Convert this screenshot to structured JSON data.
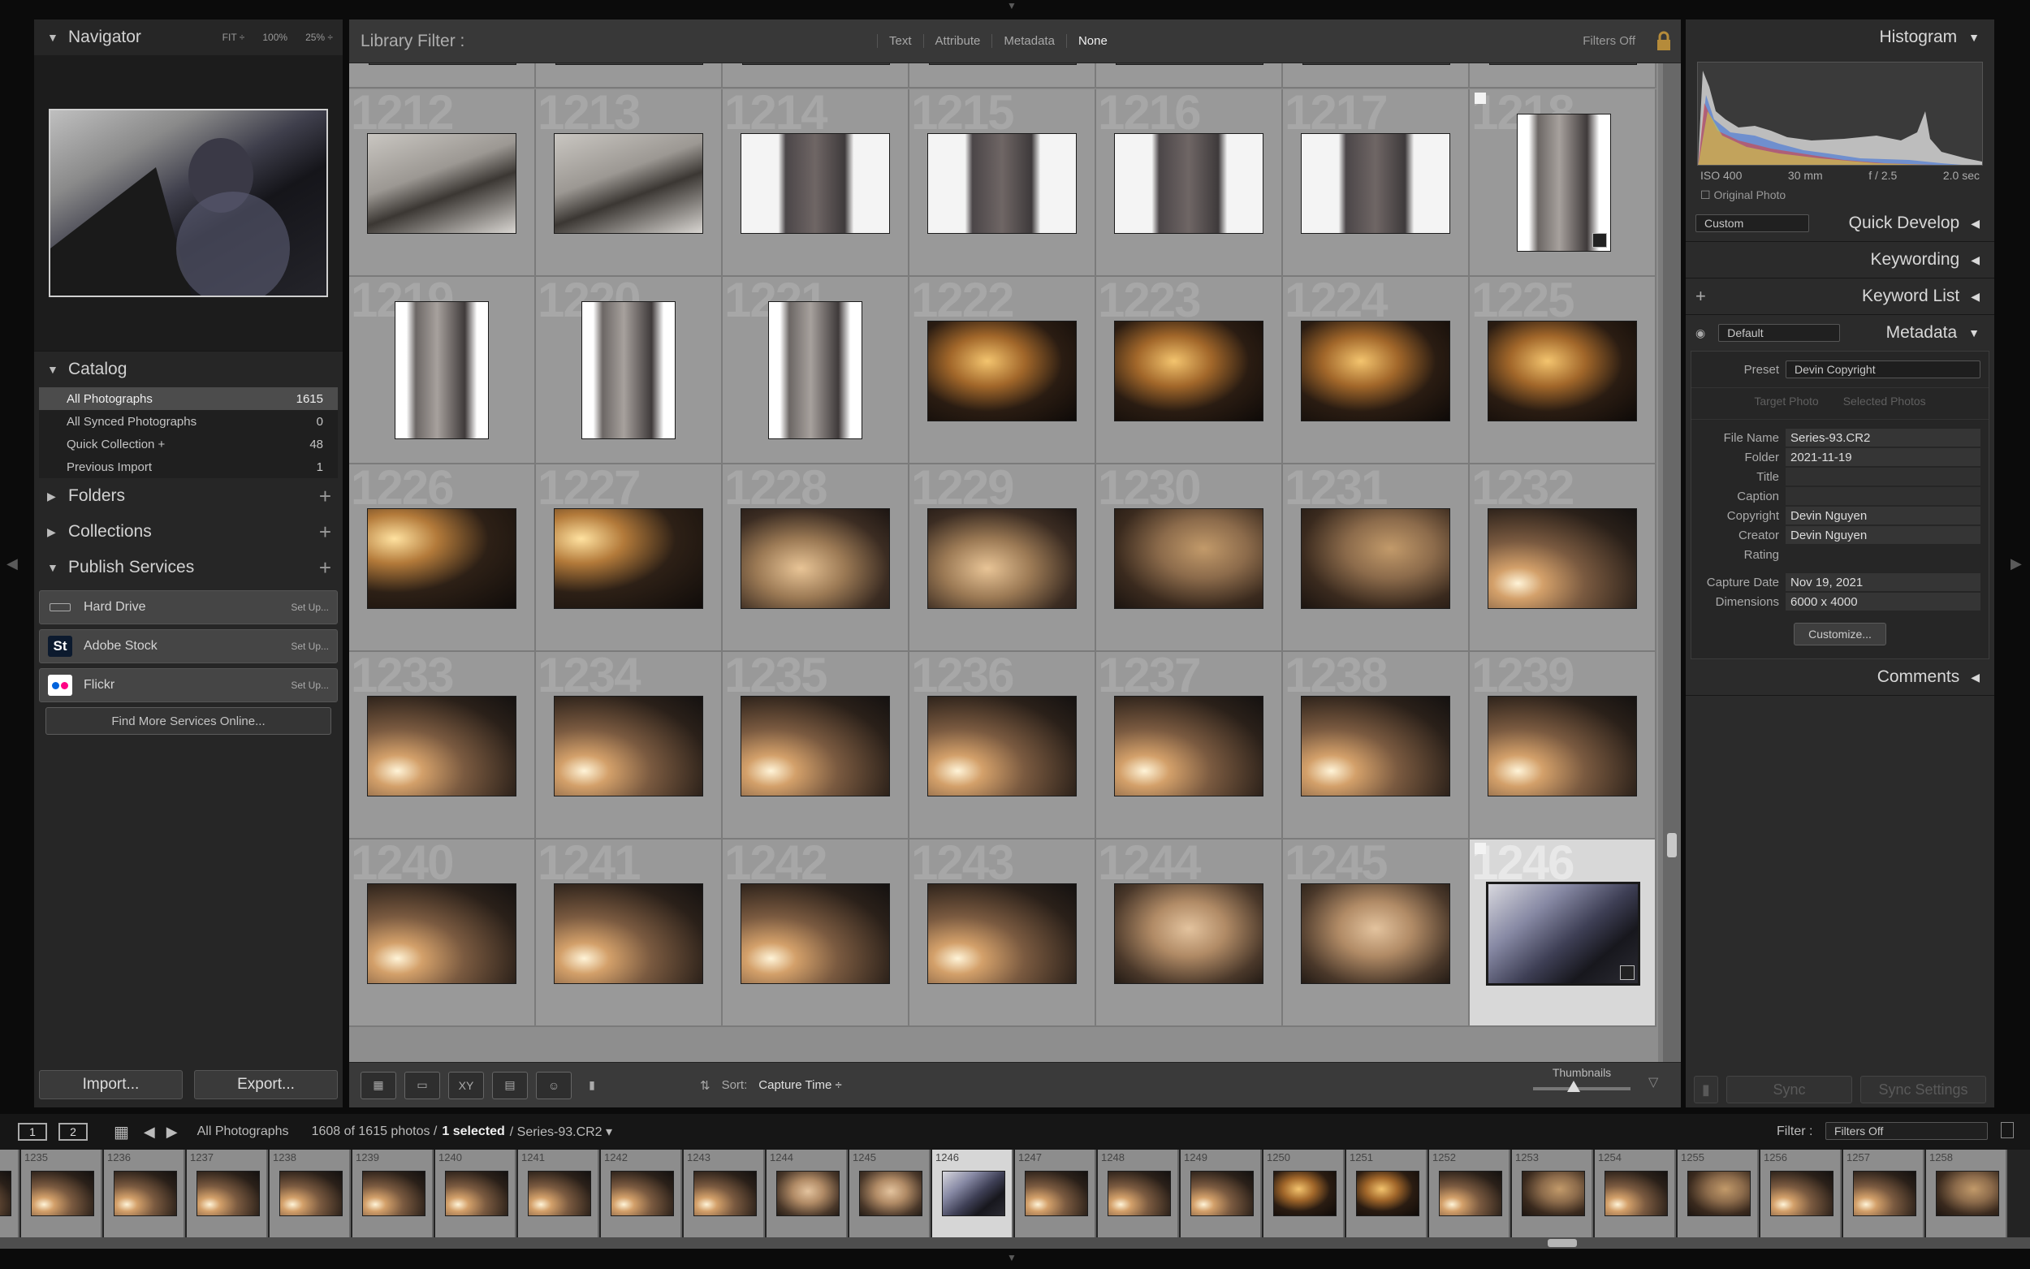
{
  "left": {
    "navigator": {
      "title": "Navigator",
      "zooms": [
        "FIT ÷",
        "100%",
        "25% ÷"
      ]
    },
    "catalog": {
      "title": "Catalog",
      "rows": [
        {
          "label": "All Photographs",
          "count": "1615"
        },
        {
          "label": "All Synced Photographs",
          "count": "0"
        },
        {
          "label": "Quick Collection +",
          "count": "48"
        },
        {
          "label": "Previous Import",
          "count": "1"
        }
      ]
    },
    "folders": "Folders",
    "collections": "Collections",
    "publish": {
      "title": "Publish Services",
      "items": [
        {
          "label": "Hard Drive",
          "setup": "Set Up..."
        },
        {
          "label": "Adobe Stock",
          "setup": "Set Up..."
        },
        {
          "label": "Flickr",
          "setup": "Set Up..."
        }
      ],
      "find_more": "Find More Services Online..."
    },
    "import": "Import...",
    "export": "Export..."
  },
  "filter": {
    "title": "Library Filter :",
    "options": [
      "Text",
      "Attribute",
      "Metadata",
      "None"
    ],
    "status": "Filters Off"
  },
  "grid": {
    "rows": [
      [
        "1212",
        "1213",
        "1214",
        "1215",
        "1216",
        "1217",
        "1218"
      ],
      [
        "1219",
        "1220",
        "1221",
        "1222",
        "1223",
        "1224",
        "1225"
      ],
      [
        "1226",
        "1227",
        "1228",
        "1229",
        "1230",
        "1231",
        "1232"
      ],
      [
        "1233",
        "1234",
        "1235",
        "1236",
        "1237",
        "1238",
        "1239"
      ],
      [
        "1240",
        "1241",
        "1242",
        "1243",
        "1244",
        "1245",
        "1246"
      ]
    ]
  },
  "toolbar": {
    "sort_label": "Sort:",
    "sort_value": "Capture Time ÷",
    "thumbnails": "Thumbnails"
  },
  "right": {
    "histogram": {
      "title": "Histogram",
      "iso": "ISO 400",
      "focal": "30 mm",
      "aperture": "f / 2.5",
      "shutter": "2.0 sec",
      "original": "Original Photo"
    },
    "quick_develop": {
      "title": "Quick Develop",
      "preset": "Custom"
    },
    "keywording": "Keywording",
    "keyword_list": "Keyword List",
    "metadata": {
      "title": "Metadata",
      "preset_sel": "Default",
      "preset_label": "Preset",
      "preset_value": "Devin Copyright",
      "target": "Target Photo",
      "selected": "Selected Photos",
      "fields": [
        {
          "label": "File Name",
          "value": "Series-93.CR2"
        },
        {
          "label": "Folder",
          "value": "2021-11-19"
        },
        {
          "label": "Title",
          "value": ""
        },
        {
          "label": "Caption",
          "value": ""
        },
        {
          "label": "Copyright",
          "value": "Devin Nguyen"
        },
        {
          "label": "Creator",
          "value": "Devin Nguyen"
        },
        {
          "label": "Rating",
          "value": ""
        },
        {
          "label": "Capture Date",
          "value": "Nov 19, 2021"
        },
        {
          "label": "Dimensions",
          "value": "6000 x 4000"
        }
      ],
      "customize": "Customize..."
    },
    "comments": "Comments",
    "sync": "Sync",
    "sync_settings": "Sync Settings"
  },
  "status": {
    "screen1": "1",
    "screen2": "2",
    "source": "All Photographs",
    "count": "1608 of 1615 photos /",
    "selected": "1 selected",
    "file": "/ Series-93.CR2 ▾",
    "filter_label": "Filter :",
    "filter_value": "Filters Off"
  },
  "film": [
    "",
    "1235",
    "1236",
    "1237",
    "1238",
    "1239",
    "1240",
    "1241",
    "1242",
    "1243",
    "1244",
    "1245",
    "1246",
    "1247",
    "1248",
    "1249",
    "1250",
    "1251",
    "1252",
    "1253",
    "1254",
    "1255",
    "1256",
    "1257",
    "1258"
  ]
}
